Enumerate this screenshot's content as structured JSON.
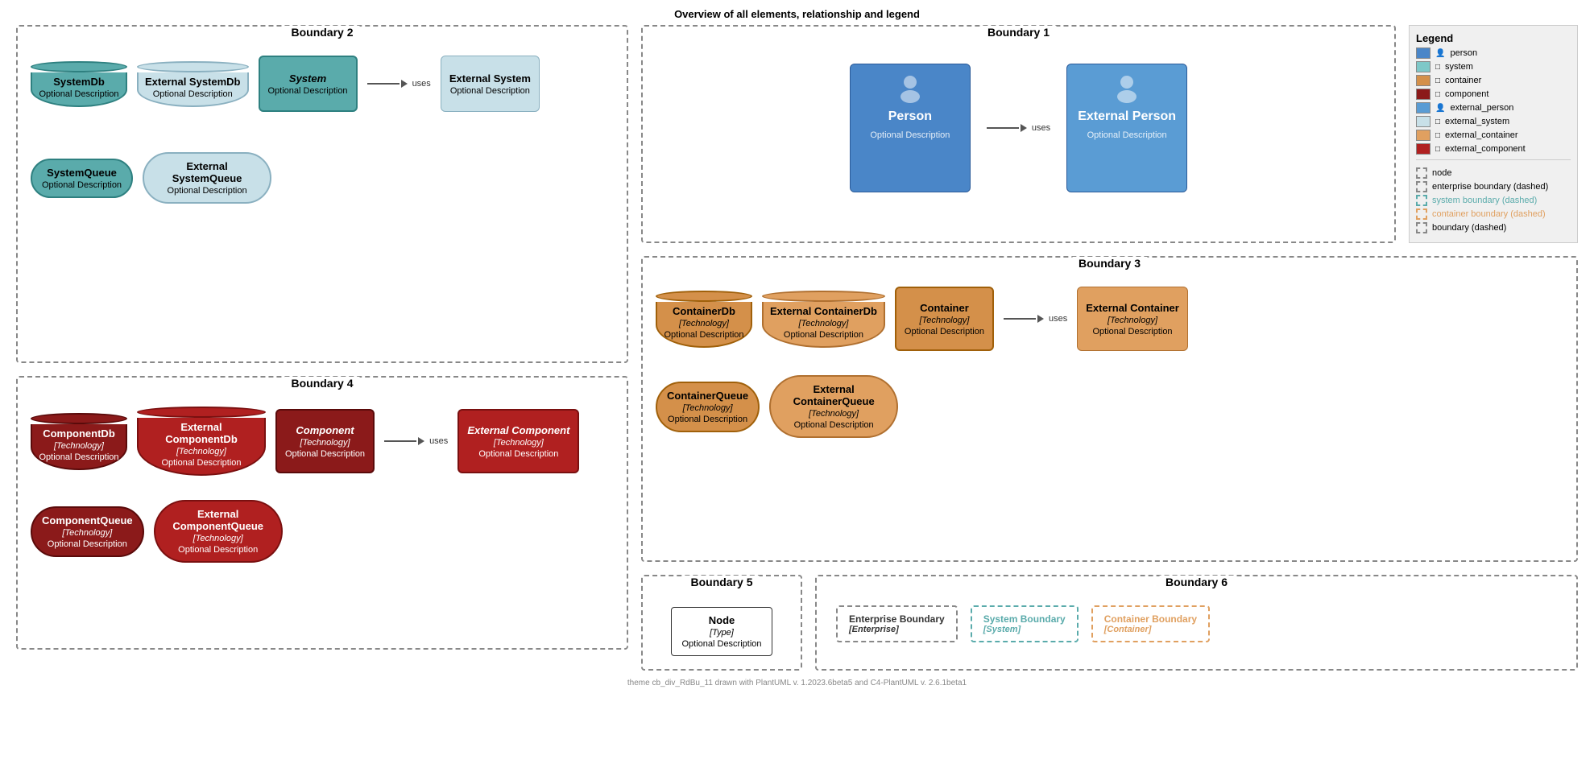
{
  "title": "Overview of all elements, relationship and legend",
  "footer": "theme cb_div_RdBu_11 drawn with PlantUML v. 1.2023.6beta5 and C4-PlantUML v. 2.6.1beta1",
  "boundary2": {
    "title": "Boundary 2",
    "items": [
      {
        "id": "systemdb",
        "label": "SystemDb",
        "desc": "Optional Description",
        "type": "cyl-system-bold"
      },
      {
        "id": "ext-systemdb",
        "label": "External SystemDb",
        "desc": "Optional Description",
        "type": "cyl-external"
      },
      {
        "id": "system",
        "label": "System",
        "desc": "Optional Description",
        "type": "card-system-bold"
      },
      {
        "id": "ext-system",
        "label": "External System",
        "desc": "Optional Description",
        "type": "card-external-system"
      }
    ],
    "items2": [
      {
        "id": "systemqueue",
        "label": "SystemQueue",
        "desc": "Optional Description",
        "type": "q-system"
      },
      {
        "id": "ext-systemqueue",
        "label": "External SystemQueue",
        "desc": "Optional Description",
        "type": "q-external"
      }
    ],
    "arrow_label": "uses"
  },
  "boundary1": {
    "title": "Boundary 1",
    "person": {
      "label": "Person",
      "desc": "Optional Description"
    },
    "ext_person": {
      "label": "External Person",
      "desc": "Optional Description"
    },
    "arrow_label": "uses"
  },
  "legend": {
    "title": "Legend",
    "items": [
      {
        "label": "person",
        "color": "#4a86c8",
        "icon": "👤"
      },
      {
        "label": "system",
        "color": "#7ec8c8",
        "icon": ""
      },
      {
        "label": "container",
        "color": "#d4904a",
        "icon": ""
      },
      {
        "label": "component",
        "color": "#8b1a1a",
        "icon": ""
      },
      {
        "label": "external_person",
        "color": "#5a9cd4",
        "icon": "👤"
      },
      {
        "label": "external_system",
        "color": "#c8e0e8",
        "icon": ""
      },
      {
        "label": "external_container",
        "color": "#e0a060",
        "icon": ""
      },
      {
        "label": "external_component",
        "color": "#b02020",
        "icon": ""
      }
    ],
    "boundary_items": [
      {
        "label": "node",
        "style": "plain"
      },
      {
        "label": "enterprise boundary (dashed)",
        "style": "dashed"
      },
      {
        "label": "system boundary (dashed)",
        "style": "dashed-sys"
      },
      {
        "label": "container boundary (dashed)",
        "style": "dashed-cont"
      },
      {
        "label": "boundary (dashed)",
        "style": "dashed"
      }
    ]
  },
  "boundary3": {
    "title": "Boundary 3",
    "items": [
      {
        "id": "containerdb",
        "label": "ContainerDb",
        "tech": "[Technology]",
        "desc": "Optional Description",
        "type": "container"
      },
      {
        "id": "ext-containerdb",
        "label": "External ContainerDb",
        "tech": "[Technology]",
        "desc": "Optional Description",
        "type": "ext-container"
      },
      {
        "id": "container",
        "label": "Container",
        "tech": "[Technology]",
        "desc": "Optional Description",
        "type": "container"
      },
      {
        "id": "ext-container",
        "label": "External Container",
        "tech": "[Technology]",
        "desc": "Optional Description",
        "type": "ext-container"
      }
    ],
    "items2": [
      {
        "id": "containerqueue",
        "label": "ContainerQueue",
        "tech": "[Technology]",
        "desc": "Optional Description",
        "type": "container"
      },
      {
        "id": "ext-containerqueue",
        "label": "External ContainerQueue",
        "tech": "[Technology]",
        "desc": "Optional Description",
        "type": "ext-container"
      }
    ],
    "arrow_label": "uses"
  },
  "boundary4": {
    "title": "Boundary 4",
    "items": [
      {
        "id": "componentdb",
        "label": "ComponentDb",
        "tech": "[Technology]",
        "desc": "Optional Description",
        "type": "component"
      },
      {
        "id": "ext-componentdb",
        "label": "External ComponentDb",
        "tech": "[Technology]",
        "desc": "Optional Description",
        "type": "ext-component"
      },
      {
        "id": "component",
        "label": "Component",
        "tech": "[Technology]",
        "desc": "Optional Description",
        "type": "component"
      },
      {
        "id": "ext-component",
        "label": "External Component",
        "tech": "[Technology]",
        "desc": "Optional Description",
        "type": "ext-component"
      }
    ],
    "items2": [
      {
        "id": "componentqueue",
        "label": "ComponentQueue",
        "tech": "[Technology]",
        "desc": "Optional Description",
        "type": "component"
      },
      {
        "id": "ext-componentqueue",
        "label": "External ComponentQueue",
        "tech": "[Technology]",
        "desc": "Optional Description",
        "type": "ext-component"
      }
    ],
    "arrow_label": "uses"
  },
  "boundary5": {
    "title": "Boundary 5",
    "node": {
      "label": "Node",
      "type": "[Type]",
      "desc": "Optional Description"
    }
  },
  "boundary6": {
    "title": "Boundary 6",
    "items": [
      {
        "label": "Enterprise Boundary",
        "sub": "[Enterprise]",
        "style": "dashed"
      },
      {
        "label": "System Boundary",
        "sub": "[System]",
        "style": "dashed-sys"
      },
      {
        "label": "Container Boundary",
        "sub": "[Container]",
        "style": "dashed-cont"
      }
    ]
  },
  "labels": {
    "uses": "uses",
    "optional_desc": "Optional Description"
  }
}
